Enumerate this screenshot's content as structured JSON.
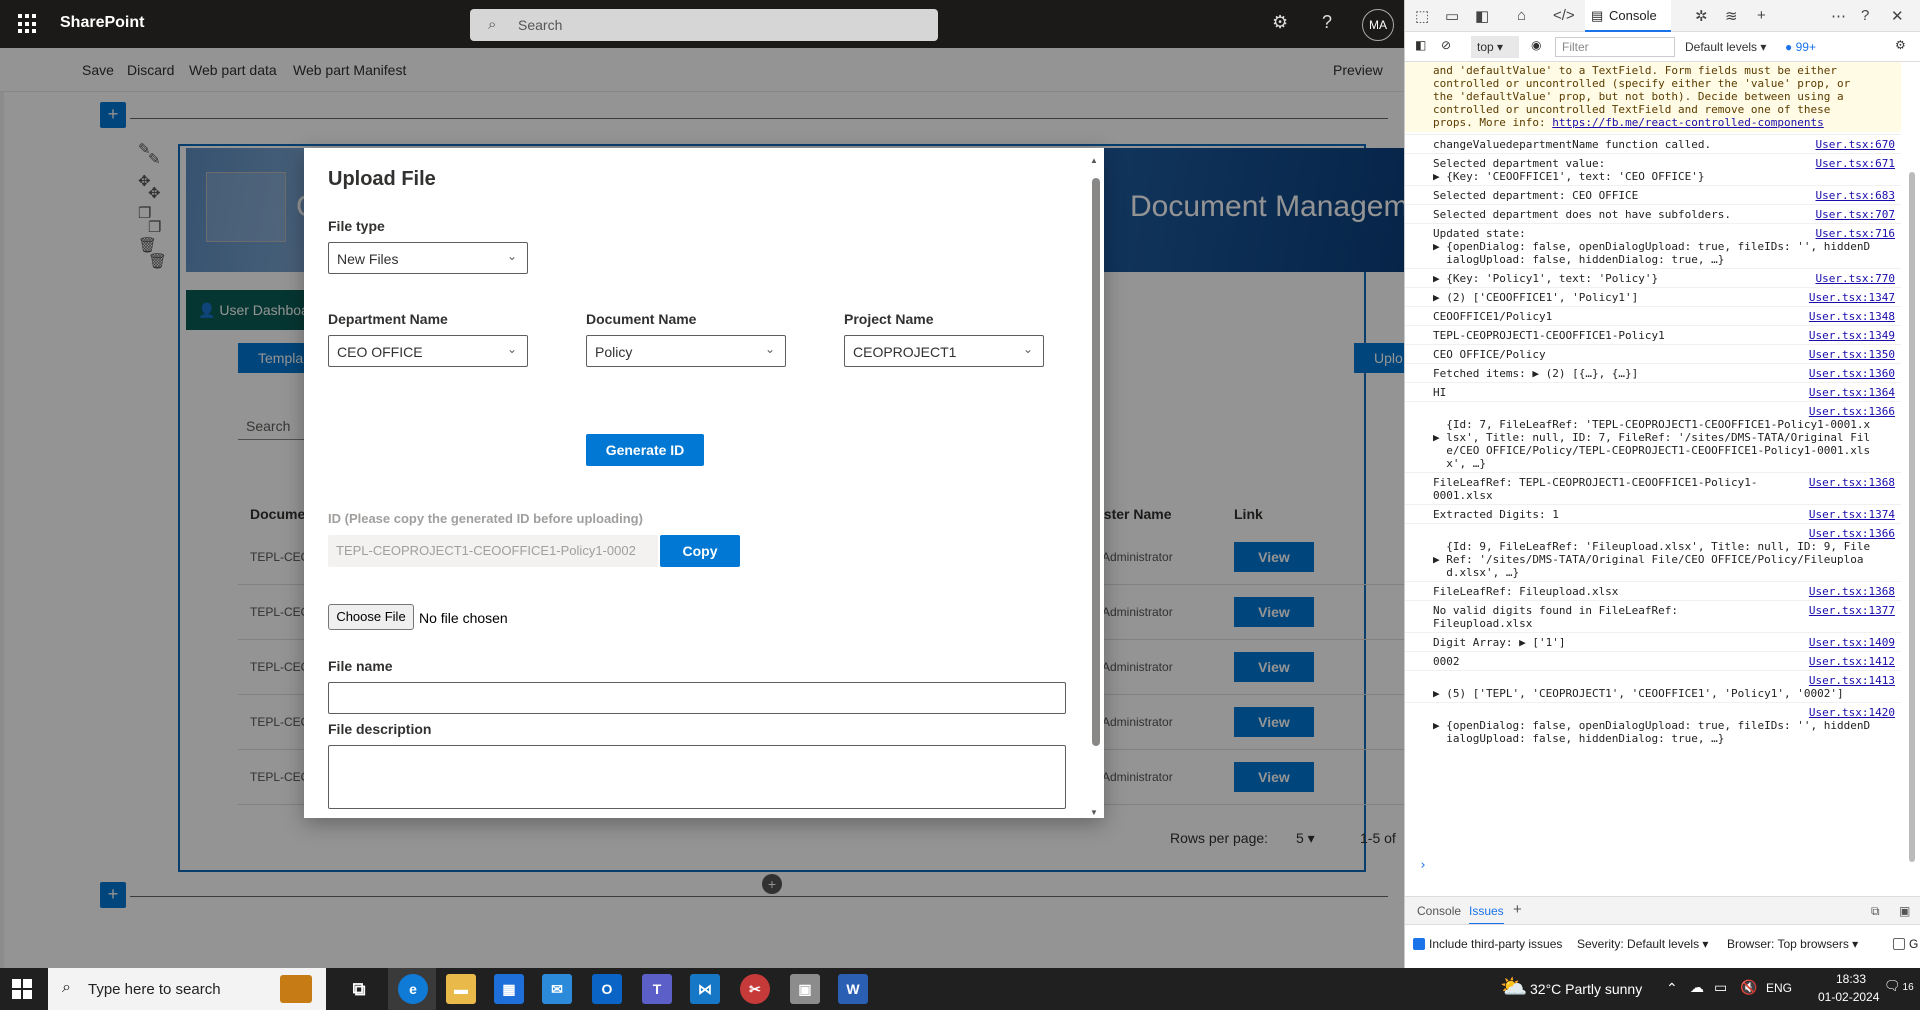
{
  "sharepoint": {
    "brand": "SharePoint",
    "search_placeholder": "Search",
    "avatar_initials": "MA"
  },
  "command_bar": {
    "save": "Save",
    "discard": "Discard",
    "web_part_data": "Web part data",
    "web_part_manifest": "Web part Manifest",
    "preview": "Preview"
  },
  "background_page": {
    "banner_title": "Document Managem",
    "banner_initial": "C",
    "dashboard_button": "User Dashboa",
    "template_button": "Templa",
    "upload_button": "Uplo",
    "search_label": "Search",
    "columns": {
      "document": "Docume",
      "requester": "ester Name",
      "link": "Link"
    },
    "rows": [
      {
        "doc": "TEPL-CEO",
        "requester": "Administrator",
        "link": "View"
      },
      {
        "doc": "TEPL-CEO",
        "requester": "Administrator",
        "link": "View"
      },
      {
        "doc": "TEPL-CEO",
        "requester": "Administrator",
        "link": "View"
      },
      {
        "doc": "TEPL-CEO",
        "requester": "Administrator",
        "link": "View"
      },
      {
        "doc": "TEPL-CEO",
        "requester": "Administrator",
        "link": "View"
      }
    ],
    "rows_per_page_label": "Rows per page:",
    "rows_per_page_value": "5",
    "range": "1-5 of"
  },
  "modal": {
    "title": "Upload File",
    "file_type_label": "File type",
    "file_type_value": "New Files",
    "department_label": "Department Name",
    "department_value": "CEO OFFICE",
    "document_label": "Document Name",
    "document_value": "Policy",
    "project_label": "Project Name",
    "project_value": "CEOPROJECT1",
    "generate_button": "Generate ID",
    "id_label": "ID (Please copy the generated ID before uploading)",
    "id_value": "TEPL-CEOPROJECT1-CEOOFFICE1-Policy1-0002",
    "copy_button": "Copy",
    "choose_file_button": "Choose File",
    "no_file_text": "No file chosen",
    "file_name_label": "File name",
    "file_description_label": "File description"
  },
  "devtools": {
    "console_tab": "Console",
    "context": "top",
    "filter_placeholder": "Filter",
    "levels": "Default levels",
    "issues_count": "99+",
    "warning_lines": [
      "and 'defaultValue' to a TextField. Form fields must be either",
      "controlled or uncontrolled (specify either the 'value' prop, or",
      "the 'defaultValue' prop, but not both). Decide between using a",
      "controlled or uncontrolled TextField and remove one of these",
      "props. More info: "
    ],
    "warning_link": "https://fb.me/react-controlled-components",
    "logs": [
      {
        "msg": "changeValuedepartmentName function called.",
        "src": "User.tsx:670"
      },
      {
        "msg": "Selected department value:\n▶ {Key: 'CEOOFFICE1', text: 'CEO OFFICE'}",
        "src": "User.tsx:671"
      },
      {
        "msg": "Selected department: CEO OFFICE",
        "src": "User.tsx:683"
      },
      {
        "msg": "Selected department does not have subfolders.",
        "src": "User.tsx:707"
      },
      {
        "msg": "Updated state:\n▶ {openDialog: false, openDialogUpload: true, fileIDs: '', hiddenD\n  ialogUpload: false, hiddenDialog: true, …}",
        "src": "User.tsx:716"
      },
      {
        "msg": "▶ {Key: 'Policy1', text: 'Policy'}",
        "src": "User.tsx:770"
      },
      {
        "msg": "▶ (2) ['CEOOFFICE1', 'Policy1']",
        "src": "User.tsx:1347"
      },
      {
        "msg": "CEOOFFICE1/Policy1",
        "src": "User.tsx:1348"
      },
      {
        "msg": "TEPL-CEOPROJECT1-CEOOFFICE1-Policy1",
        "src": "User.tsx:1349"
      },
      {
        "msg": "CEO OFFICE/Policy",
        "src": "User.tsx:1350"
      },
      {
        "msg": "Fetched items: ▶ (2) [{…}, {…}]",
        "src": "User.tsx:1360"
      },
      {
        "msg": "HI",
        "src": "User.tsx:1364"
      },
      {
        "msg": "\n  {Id: 7, FileLeafRef: 'TEPL-CEOPROJECT1-CEOOFFICE1-Policy1-0001.x\n▶ lsx', Title: null, ID: 7, FileRef: '/sites/DMS-TATA/Original Fil\n  e/CEO OFFICE/Policy/TEPL-CEOPROJECT1-CEOOFFICE1-Policy1-0001.xls\n  x', …}",
        "src": "User.tsx:1366"
      },
      {
        "msg": "FileLeafRef: TEPL-CEOPROJECT1-CEOOFFICE1-Policy1-\n0001.xlsx",
        "src": "User.tsx:1368"
      },
      {
        "msg": "Extracted Digits: 1",
        "src": "User.tsx:1374"
      },
      {
        "msg": "\n  {Id: 9, FileLeafRef: 'Fileupload.xlsx', Title: null, ID: 9, File\n▶ Ref: '/sites/DMS-TATA/Original File/CEO OFFICE/Policy/Fileuploa\n  d.xlsx', …}",
        "src": "User.tsx:1366"
      },
      {
        "msg": "FileLeafRef: Fileupload.xlsx",
        "src": "User.tsx:1368"
      },
      {
        "msg": "No valid digits found in FileLeafRef:\nFileupload.xlsx",
        "src": "User.tsx:1377"
      },
      {
        "msg": "Digit Array: ▶ ['1']",
        "src": "User.tsx:1409"
      },
      {
        "msg": "0002",
        "src": "User.tsx:1412"
      },
      {
        "msg": "\n▶ (5) ['TEPL', 'CEOPROJECT1', 'CEOOFFICE1', 'Policy1', '0002']",
        "src": "User.tsx:1413"
      },
      {
        "msg": "\n▶ {openDialog: false, openDialogUpload: true, fileIDs: '', hiddenD\n  ialogUpload: false, hiddenDialog: true, …}",
        "src": "User.tsx:1420"
      }
    ],
    "bottom_tabs": {
      "console": "Console",
      "issues": "Issues"
    },
    "third_party": "Include third-party issues",
    "severity_label": "Severity:",
    "severity_value": "Default levels",
    "browser_label": "Browser:",
    "browser_value": "Top browsers",
    "last_option": "G"
  },
  "taskbar": {
    "search_placeholder": "Type here to search",
    "weather": "32°C  Partly sunny",
    "language": "ENG",
    "time": "18:33",
    "date": "01-02-2024",
    "notifications": "16"
  }
}
